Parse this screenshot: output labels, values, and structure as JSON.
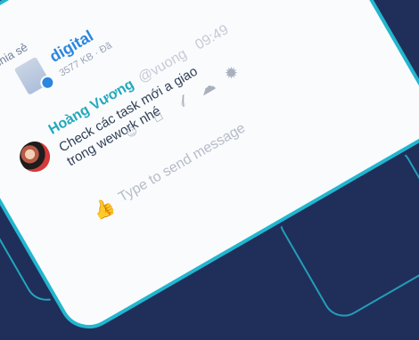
{
  "conversation": {
    "message_prefix": "chia sẻ",
    "attachment": {
      "name": "digital",
      "meta": "3577 KB · Đã",
      "icon": "document-icon"
    },
    "message": {
      "sender": "Hoàng Vương",
      "handle": "@vuong",
      "time": "09:49",
      "text": "Check các task mới a giao trong wework nhé",
      "avatar": "avatar"
    },
    "action_icons": [
      "smile-icon",
      "gift-icon",
      "paperclip-icon",
      "cloud-icon",
      "gear-icon"
    ],
    "composer": {
      "like_icon": "thumbs-up-icon",
      "placeholder": "Type to send message"
    }
  }
}
